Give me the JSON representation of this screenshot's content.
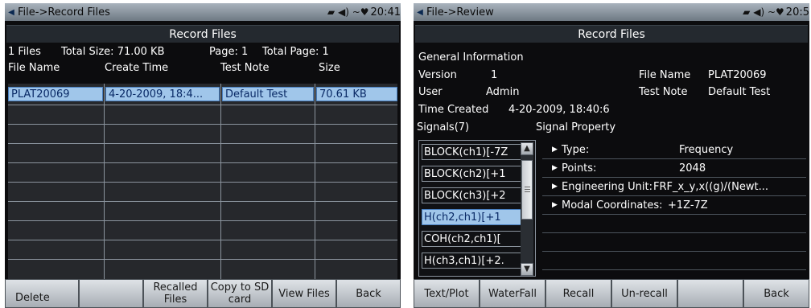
{
  "left_screen": {
    "status_bar": {
      "path": "File->Record Files",
      "clock": "20:41"
    },
    "header": "Record Files",
    "info": {
      "files": "1 Files",
      "total_size": "Total Size: 71.00 KB",
      "page": "Page: 1",
      "total_page": "Total Page: 1"
    },
    "columns": [
      "File Name",
      "Create Time",
      "Test Note",
      "Size"
    ],
    "rows": [
      {
        "file_name": "PLAT20069",
        "create_time": "4-20-2009, 18:4...",
        "test_note": "Default Test",
        "size": "70.61 KB"
      }
    ],
    "softkeys": [
      {
        "label": "Delete"
      },
      {
        "label": ""
      },
      {
        "label": "Recalled Files"
      },
      {
        "label": "Copy to SD card"
      },
      {
        "label": "View Files"
      },
      {
        "label": "Back"
      }
    ]
  },
  "right_screen": {
    "status_bar": {
      "path": "File->Review",
      "clock": "20:5"
    },
    "header": "Record Files",
    "general": {
      "title": "General Information",
      "version_label": "Version",
      "version_value": "1",
      "user_label": "User",
      "user_value": "Admin",
      "file_name_label": "File Name",
      "file_name_value": "PLAT20069",
      "test_note_label": "Test Note",
      "test_note_value": "Default Test",
      "time_created_label": "Time Created",
      "time_created_value": "4-20-2009, 18:40:6"
    },
    "signals_title": "Signals(7)",
    "signal_property_title": "Signal Property",
    "signals": [
      {
        "label": "BLOCK(ch1)[-7Z"
      },
      {
        "label": "BLOCK(ch2)[+1"
      },
      {
        "label": "BLOCK(ch3)[+2"
      },
      {
        "label": "H(ch2,ch1)[+1"
      },
      {
        "label": "COH(ch2,ch1)["
      },
      {
        "label": "H(ch3,ch1)[+2."
      }
    ],
    "selected_signal_index": 3,
    "properties": [
      {
        "key": "Type:",
        "value": "Frequency"
      },
      {
        "key": "Points:",
        "value": "2048"
      },
      {
        "key": "Engineering Unit:",
        "value": "FRF_x_y,x((g)/(Newt..."
      },
      {
        "key": "Modal Coordinates:",
        "value": "+1Z-7Z"
      }
    ],
    "softkeys": [
      {
        "label": "Text/Plot"
      },
      {
        "label": "WaterFall"
      },
      {
        "label": "Recall"
      },
      {
        "label": "Un-recall"
      },
      {
        "label": ""
      },
      {
        "label": "Back"
      }
    ]
  },
  "colors": {
    "selection": "#a0c6ea",
    "screen_bg": "#0c0c0e",
    "softkey": "#c6cbd0"
  },
  "icons": {
    "status": [
      "signal-icon",
      "volume-icon",
      "battery-icon"
    ]
  }
}
